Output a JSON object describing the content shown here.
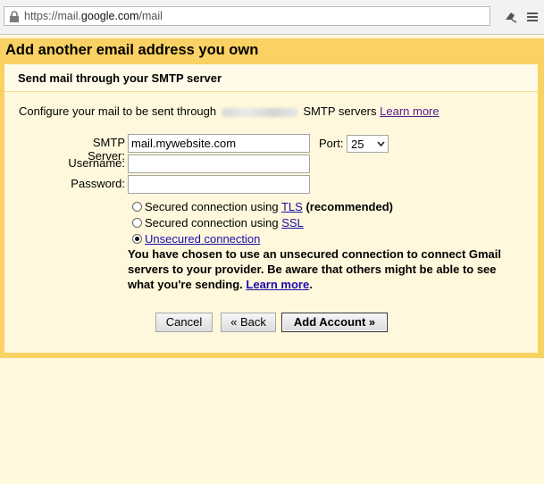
{
  "browser": {
    "url_prefix": "https://mail.",
    "url_domain": "google.com",
    "url_suffix": "/mail"
  },
  "dialog": {
    "title": "Add another email address you own",
    "section_title": "Send mail through your SMTP server",
    "intro_before": "Configure your mail to be sent through",
    "intro_after": "SMTP servers",
    "intro_link": "Learn more"
  },
  "form": {
    "smtp_label": "SMTP Server:",
    "smtp_value": "mail.mywebsite.com",
    "port_label": "Port:",
    "port_value": "25",
    "username_label": "Username:",
    "username_value": "",
    "password_label": "Password:",
    "password_value": ""
  },
  "security": {
    "options": [
      {
        "prefix": "Secured connection using ",
        "link": "TLS",
        "suffix": " (recommended)",
        "selected": false
      },
      {
        "prefix": "Secured connection using ",
        "link": "SSL",
        "suffix": "",
        "selected": false
      },
      {
        "prefix": "",
        "link": "Unsecured connection",
        "suffix": "",
        "selected": true
      }
    ],
    "warning_text": "You have chosen to use an unsecured connection to connect Gmail servers to your provider. Be aware that others might be able to see what you're sending.",
    "warning_link": "Learn more"
  },
  "buttons": {
    "cancel": "Cancel",
    "back": "« Back",
    "add_account": "Add Account »"
  }
}
